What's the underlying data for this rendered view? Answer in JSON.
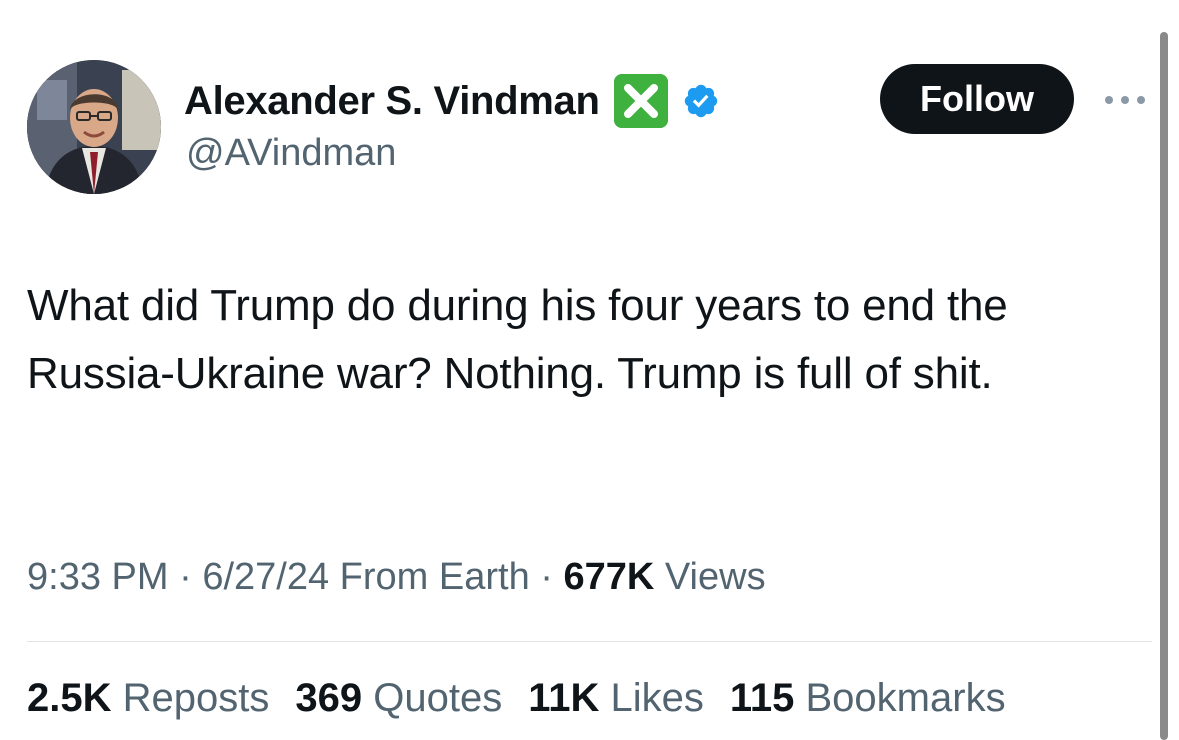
{
  "author": {
    "name": "Alexander S. Vindman",
    "handle": "@AVindman",
    "badge_icon": "cross-mark-emoji-icon",
    "verified_icon": "verified-badge-icon"
  },
  "actions": {
    "follow_label": "Follow",
    "more_icon": "more-options-icon"
  },
  "tweet": {
    "text": "What did Trump do during his four years to end the Russia-Ukraine war? Nothing. Trump is full of shit."
  },
  "meta": {
    "time": "9:33 PM",
    "sep1": " · ",
    "date": "6/27/24",
    "source": " From Earth",
    "sep2": " · ",
    "views_count": "677K",
    "views_label": " Views"
  },
  "stats": [
    {
      "count": "2.5K",
      "label": " Reposts"
    },
    {
      "count": "369",
      "label": " Quotes"
    },
    {
      "count": "11K",
      "label": " Likes"
    },
    {
      "count": "115",
      "label": " Bookmarks"
    }
  ],
  "colors": {
    "text": "#0f1419",
    "secondary": "#536471",
    "follow_bg": "#0f1419",
    "verified_blue": "#1d9bf0",
    "badge_green": "#3fb13f"
  }
}
